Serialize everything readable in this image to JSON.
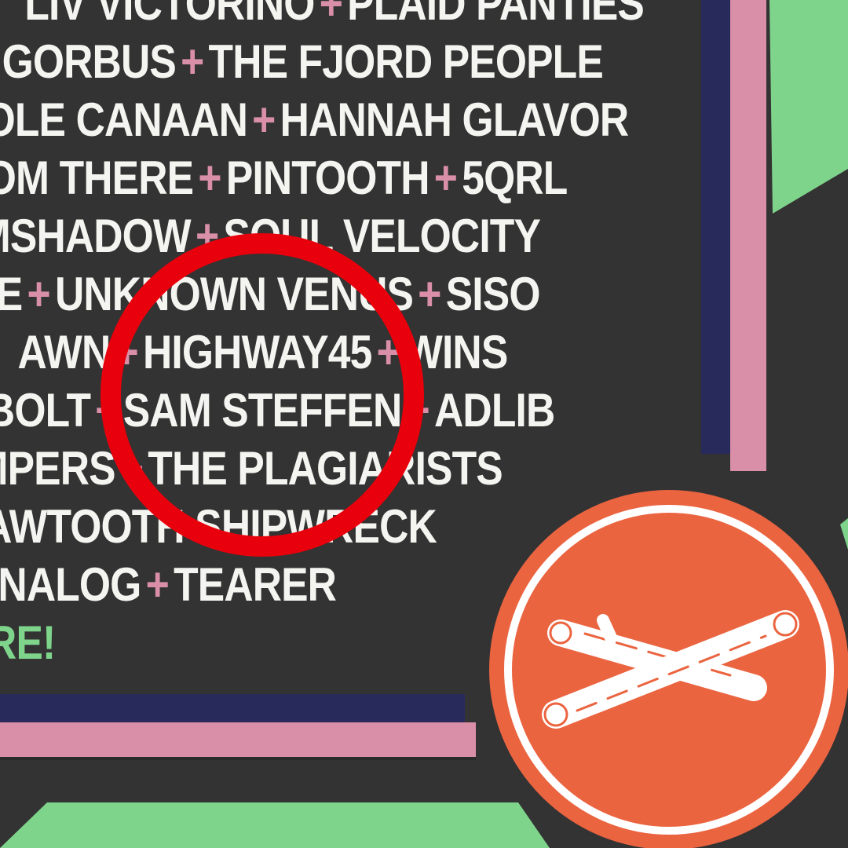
{
  "lineup": {
    "lines": [
      {
        "artists": [
          "LIV VICTORINO",
          "PLAID PANTIES"
        ]
      },
      {
        "artists": [
          "N GORBUS",
          "THE FJORD PEOPLE"
        ]
      },
      {
        "artists": [
          "OLE CANAAN",
          "HANNAH GLAVOR"
        ]
      },
      {
        "artists": [
          "OM THERE",
          "PINTOOTH",
          "5QRL"
        ]
      },
      {
        "artists": [
          "MSHADOW",
          "SOUL VELOCITY"
        ]
      },
      {
        "artists": [
          "E",
          "UNKNOWN VENUS",
          "SISO"
        ]
      },
      {
        "artists": [
          "AWN",
          "HIGHWAY45",
          "WINS"
        ]
      },
      {
        "artists": [
          "BOLT",
          "SAM STEFFEN",
          "ADLIB"
        ]
      },
      {
        "artists": [
          "MPERS",
          "THE PLAGIARISTS"
        ]
      },
      {
        "artists": [
          "SAWTOOTH SHIPWRECK"
        ]
      },
      {
        "artists": [
          "ANALOG",
          "TEARER"
        ]
      }
    ],
    "separator": "+",
    "cta": "RE!"
  },
  "highlight": {
    "target": "SAM STEFFEN"
  },
  "colors": {
    "background": "#333333",
    "green": "#7fd48c",
    "pink": "#d98fa8",
    "navy": "#272a5a",
    "orange": "#eb6440",
    "red_circle": "#e8000c",
    "text": "#f4f4f0"
  },
  "icons": {
    "badge": "crossed-logs-icon",
    "highlight": "red-highlight-circle"
  }
}
